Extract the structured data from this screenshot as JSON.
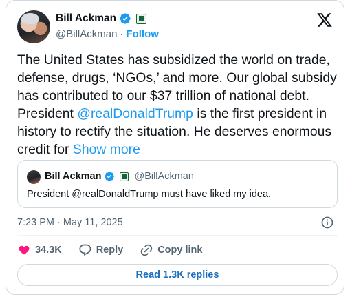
{
  "author": {
    "name": "Bill Ackman",
    "handle": "@BillAckman",
    "separator": "·",
    "follow_label": "Follow"
  },
  "tweet": {
    "text_part1": "The United States has subsidized the world on trade, defense, drugs, ‘NGOs,’ and more.  Our global subsidy has contributed to our $37 trillion of national debt. President ",
    "mention": "@realDonaldTrump",
    "text_part2": " is the first president in history to rectify the situation. He deserves enormous credit for ",
    "show_more": "Show more"
  },
  "quote": {
    "name": "Bill Ackman",
    "handle": "@BillAckman",
    "text": "President @realDonaldTrump must have liked my idea."
  },
  "meta": {
    "timestamp": "7:23 PM · May 11, 2025"
  },
  "actions": {
    "like_count": "34.3K",
    "reply_label": "Reply",
    "copy_link_label": "Copy link"
  },
  "read_replies_label": "Read 1.3K replies",
  "colors": {
    "link": "#1d9bf0",
    "like": "#f91880",
    "verified": "#1d9bf0",
    "text": "#0f1419",
    "muted": "#536471"
  },
  "icons": [
    "x-logo-icon",
    "verified-badge-icon",
    "affiliate-badge-icon",
    "info-icon",
    "heart-icon",
    "reply-icon",
    "link-icon"
  ]
}
